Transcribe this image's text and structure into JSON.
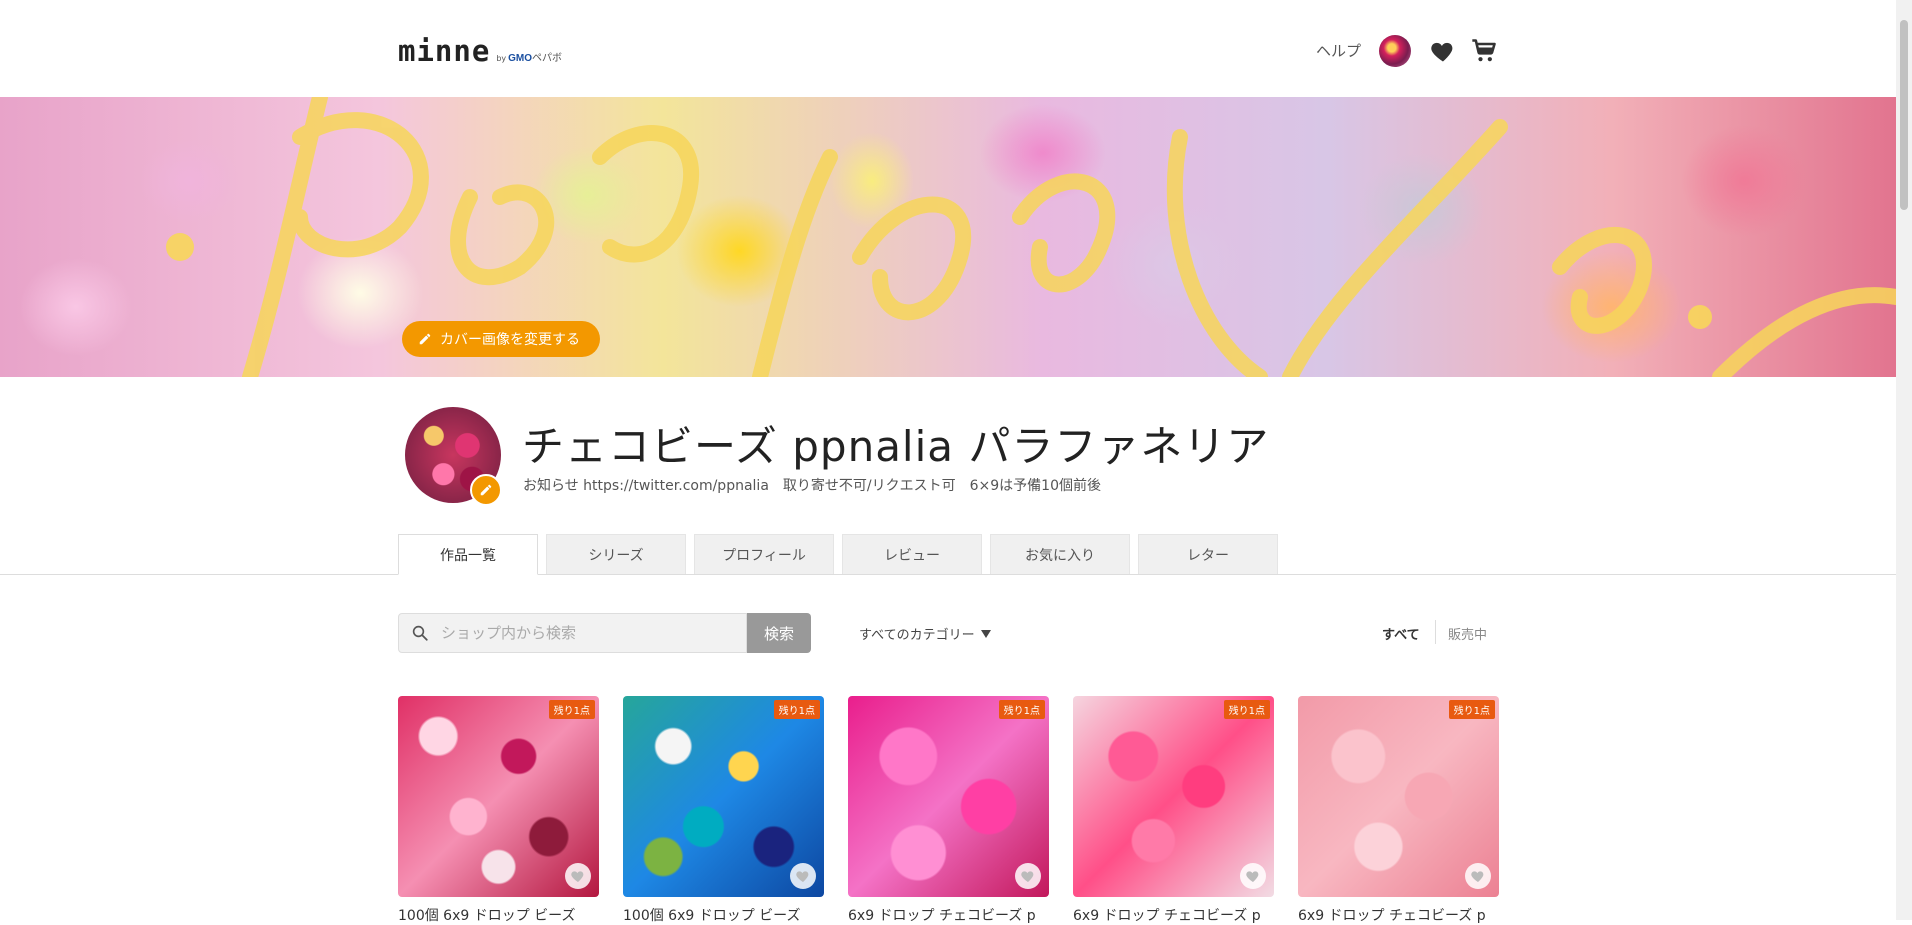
{
  "header": {
    "logo": {
      "main": "minne",
      "by": "by",
      "gmo": "GMO",
      "pepabo": "ペパボ"
    },
    "help": "ヘルプ"
  },
  "cover": {
    "change_button": "カバー画像を変更する"
  },
  "shop": {
    "name": "チェコビーズ ppnalia パラファネリア",
    "description": "お知らせ https://twitter.com/ppnalia　取り寄せ不可/リクエスト可　6×9は予備10個前後"
  },
  "tabs": [
    {
      "label": "作品一覧",
      "active": true
    },
    {
      "label": "シリーズ"
    },
    {
      "label": "プロフィール"
    },
    {
      "label": "レビュー"
    },
    {
      "label": "お気に入り"
    },
    {
      "label": "レター"
    }
  ],
  "search": {
    "placeholder": "ショップ内から検索",
    "value": "",
    "button": "検索"
  },
  "category_select": "すべてのカテゴリー",
  "filters": {
    "all": "すべて",
    "on_sale": "販売中",
    "active": "all"
  },
  "products": [
    {
      "badge": "残り1点",
      "title": "100個 6x9 ドロップ ビーズ"
    },
    {
      "badge": "残り1点",
      "title": "100個 6x9 ドロップ ビーズ"
    },
    {
      "badge": "残り1点",
      "title": "6x9 ドロップ チェコビーズ p"
    },
    {
      "badge": "残り1点",
      "title": "6x9 ドロップ チェコビーズ p"
    },
    {
      "badge": "残り1点",
      "title": "6x9 ドロップ チェコビーズ p"
    }
  ],
  "colors": {
    "accent": "#f39800",
    "badge": "#e85a10",
    "search_button": "#999999"
  },
  "icons": {
    "header": [
      "heart-icon",
      "cart-icon"
    ],
    "cover_button": "pencil-icon",
    "avatar_edit": "pencil-icon",
    "search": "search-icon",
    "category": "caret-down-icon",
    "product_fav": "heart-icon"
  }
}
